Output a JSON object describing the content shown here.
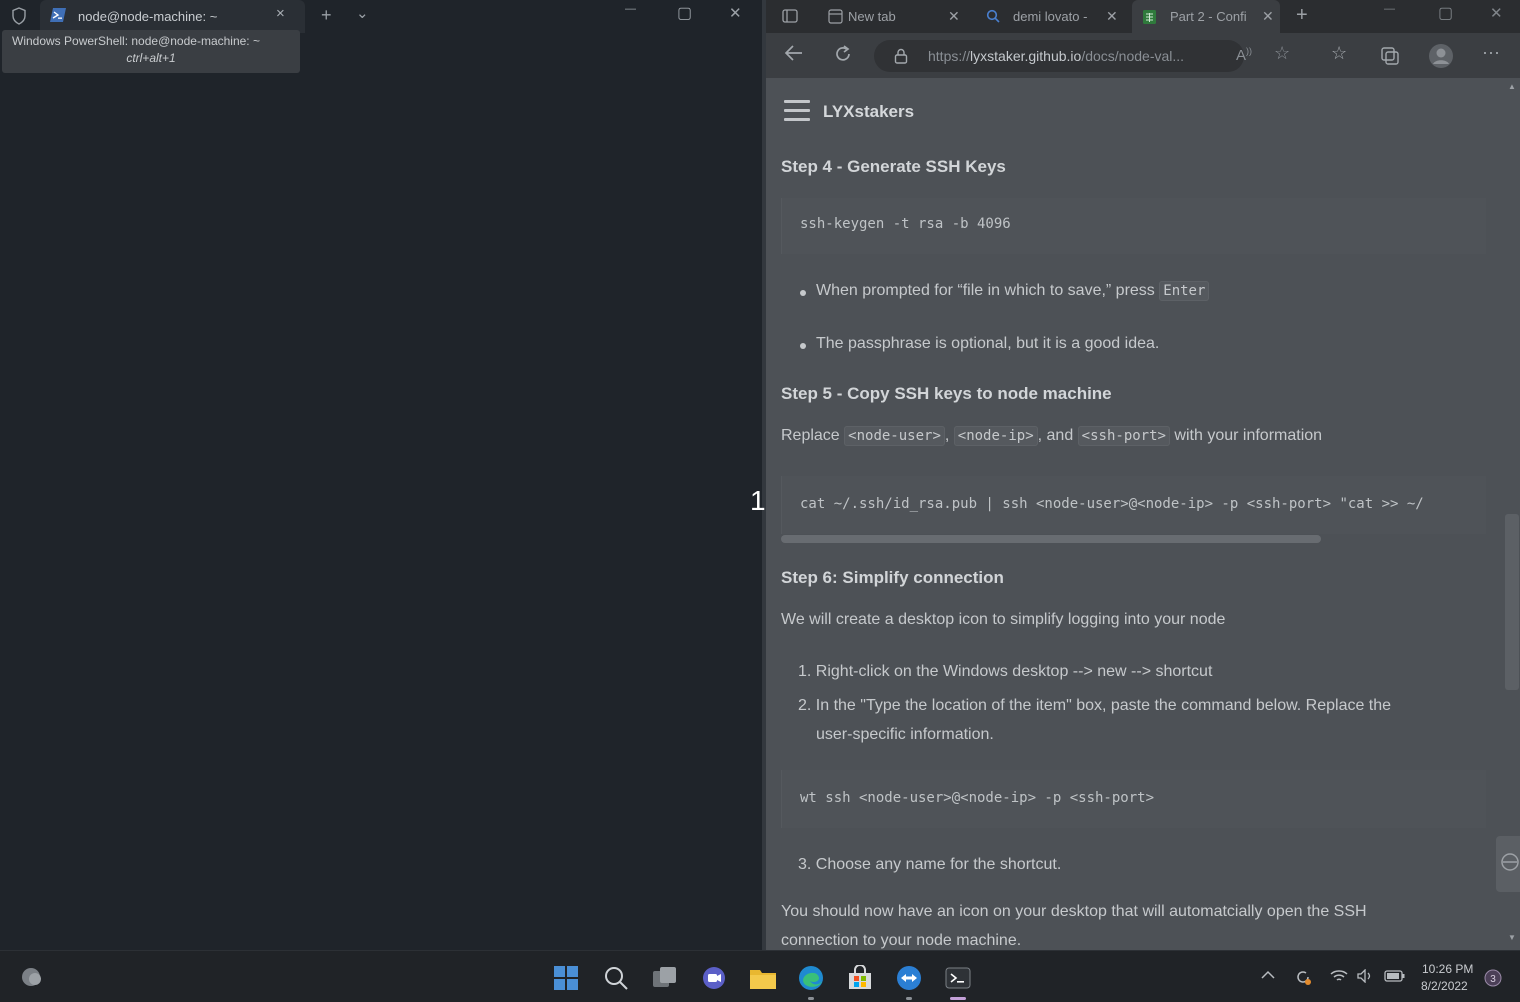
{
  "terminal": {
    "tab_title": "node@node-machine: ~",
    "tooltip_title": "Windows PowerShell: node@node-machine: ~",
    "tooltip_shortcut": "ctrl+alt+1",
    "new_tab": "+",
    "dropdown": "⌄",
    "close_tab": "×",
    "minimize": "—",
    "maximize": "▢",
    "close": "✕"
  },
  "split_indicator": "1",
  "browser": {
    "tabs": [
      {
        "label": "New tab",
        "icon": "new-tab-icon"
      },
      {
        "label": "demi lovato -",
        "icon": "search-icon"
      },
      {
        "label": "Part 2 - Confi",
        "icon": "sheet-icon"
      }
    ],
    "url_prefix": "https://",
    "url_domain": "lyxstaker.github.io",
    "url_path": "/docs/node-val...",
    "site_name": "LYXstakers"
  },
  "content": {
    "step4_heading": "Step 4 - Generate SSH Keys",
    "step4_code": "ssh-keygen -t rsa -b 4096",
    "bullet1_text": "When prompted for “file in which to save,” press",
    "bullet1_code": "Enter",
    "bullet2_text": "The passphrase is optional, but it is a good idea.",
    "step5_heading": "Step 5 - Copy SSH keys to node machine",
    "replace_word": "Replace",
    "replace_code1": "<node-user>",
    "replace_code2": "<node-ip>",
    "replace_and": ", and",
    "replace_code3": "<ssh-port>",
    "replace_tail": "with your information",
    "step5_code": "cat ~/.ssh/id_rsa.pub | ssh <node-user>@<node-ip> -p <ssh-port> \"cat >> ~/",
    "step6_heading": "Step 6: Simplify connection",
    "step6_intro": "We will create a desktop icon to simplify logging into your node",
    "list1": "1. Right-click on the Windows desktop --> new --> shortcut",
    "list2a": "2. In the \"Type the location of the item\" box, paste the command below. Replace the",
    "list2b": "user-specific information.",
    "step6_code": "wt ssh <node-user>@<node-ip> -p <ssh-port>",
    "list3": "3. Choose any name for the shortcut.",
    "closing_a": "You should now have an icon on your desktop that will automatcially open the SSH",
    "closing_b": "connection to your node machine."
  },
  "taskbar": {
    "time": "10:26 PM",
    "date": "8/2/2022"
  }
}
